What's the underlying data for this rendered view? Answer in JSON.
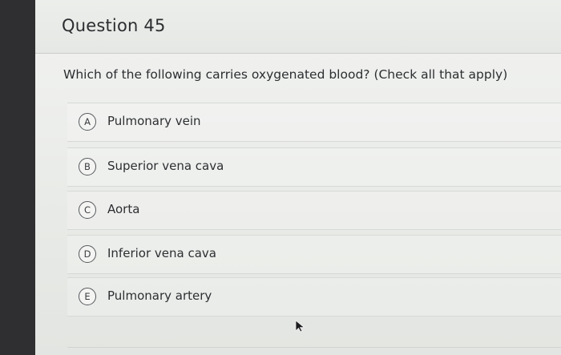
{
  "question": {
    "title": "Question 45",
    "prompt": "Which of the following carries oxygenated blood? (Check all that apply)"
  },
  "options": [
    {
      "letter": "A",
      "label": "Pulmonary vein"
    },
    {
      "letter": "B",
      "label": "Superior vena cava"
    },
    {
      "letter": "C",
      "label": "Aorta"
    },
    {
      "letter": "D",
      "label": "Inferior vena cava"
    },
    {
      "letter": "E",
      "label": "Pulmonary artery"
    }
  ],
  "icons": {
    "cursor": "mouse-pointer-icon"
  },
  "colors": {
    "background": "#2f2f31",
    "card": "#eceeeb",
    "text": "#2c2d30"
  }
}
